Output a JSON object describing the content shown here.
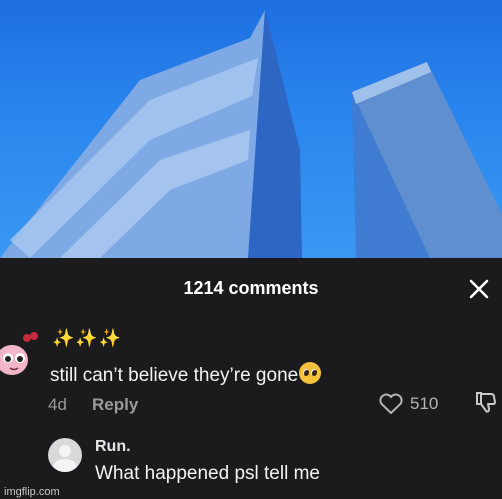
{
  "header": {
    "title": "1214 comments",
    "close_label": "×"
  },
  "comments": [
    {
      "sparkles": "✨✨✨",
      "text": "still can’t believe they’re gone",
      "emoji": "pleading-face",
      "age": "4d",
      "reply_label": "Reply",
      "likes": "510"
    },
    {
      "username": "Run.",
      "text": "What happened psl tell me"
    }
  ],
  "watermark": "imgflip.com",
  "colors": {
    "sky": "#2a86ee",
    "panel": "#1b1b1d",
    "text": "#f3f3f3",
    "muted": "#9a9a9a"
  }
}
